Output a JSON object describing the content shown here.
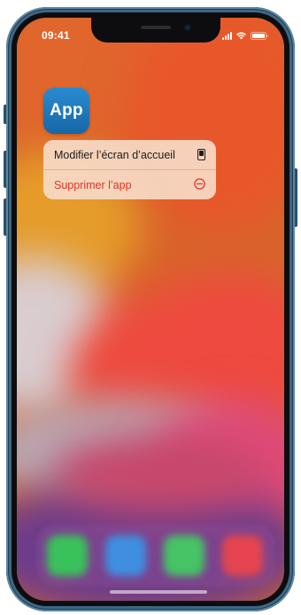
{
  "status_bar": {
    "time": "09:41",
    "signal_icon": "cellular-signal-icon",
    "wifi_icon": "wifi-icon",
    "battery_icon": "battery-icon"
  },
  "app": {
    "icon_label": "App",
    "icon_color": "#1f78bf"
  },
  "context_menu": {
    "items": [
      {
        "label": "Modifier l’écran d’accueil",
        "icon": "home-screen-phone-icon",
        "color": "#1c1c1e"
      },
      {
        "label": "Supprimer l’app",
        "icon": "minus-circle-icon",
        "color": "#e0352b"
      }
    ]
  },
  "dock": {
    "apps": [
      {
        "icon": "phone-app-icon",
        "color": "#3ac25a"
      },
      {
        "icon": "safari-app-icon",
        "color": "#3f8fe0"
      },
      {
        "icon": "messages-app-icon",
        "color": "#46c466"
      },
      {
        "icon": "music-app-icon",
        "color": "#e6454f"
      }
    ]
  },
  "device": {
    "frame_color": "#3d6886"
  }
}
